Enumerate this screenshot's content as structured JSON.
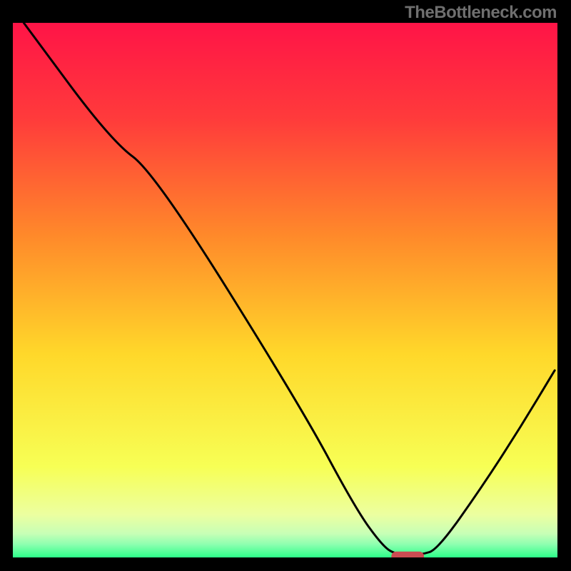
{
  "watermark": "TheBottleneck.com",
  "chart_data": {
    "type": "line",
    "title": "",
    "xlabel": "",
    "ylabel": "",
    "xlim": [
      0,
      100
    ],
    "ylim": [
      0,
      100
    ],
    "grid": false,
    "legend": false,
    "gradient_stops": [
      {
        "offset": 0,
        "color": "#ff1447"
      },
      {
        "offset": 0.18,
        "color": "#ff3b3b"
      },
      {
        "offset": 0.4,
        "color": "#ff8a2a"
      },
      {
        "offset": 0.62,
        "color": "#ffd82a"
      },
      {
        "offset": 0.83,
        "color": "#f7ff55"
      },
      {
        "offset": 0.92,
        "color": "#ecffa0"
      },
      {
        "offset": 0.955,
        "color": "#c8ffb6"
      },
      {
        "offset": 0.975,
        "color": "#8fffb0"
      },
      {
        "offset": 1.0,
        "color": "#2dff8a"
      }
    ],
    "series": [
      {
        "name": "curve",
        "color": "#000000",
        "points": [
          {
            "x": 2.0,
            "y": 100.0
          },
          {
            "x": 18.0,
            "y": 78.0
          },
          {
            "x": 26.0,
            "y": 72.0
          },
          {
            "x": 53.0,
            "y": 28.0
          },
          {
            "x": 63.0,
            "y": 9.0
          },
          {
            "x": 68.0,
            "y": 2.0
          },
          {
            "x": 70.5,
            "y": 0.5
          },
          {
            "x": 75.0,
            "y": 0.5
          },
          {
            "x": 78.0,
            "y": 1.5
          },
          {
            "x": 86.0,
            "y": 13.0
          },
          {
            "x": 93.0,
            "y": 24.0
          },
          {
            "x": 99.5,
            "y": 35.0
          }
        ]
      }
    ],
    "marker": {
      "shape": "pill",
      "color": "#cc4b52",
      "cx": 72.5,
      "cy": 0.2,
      "w": 6.0,
      "h": 1.8
    }
  }
}
